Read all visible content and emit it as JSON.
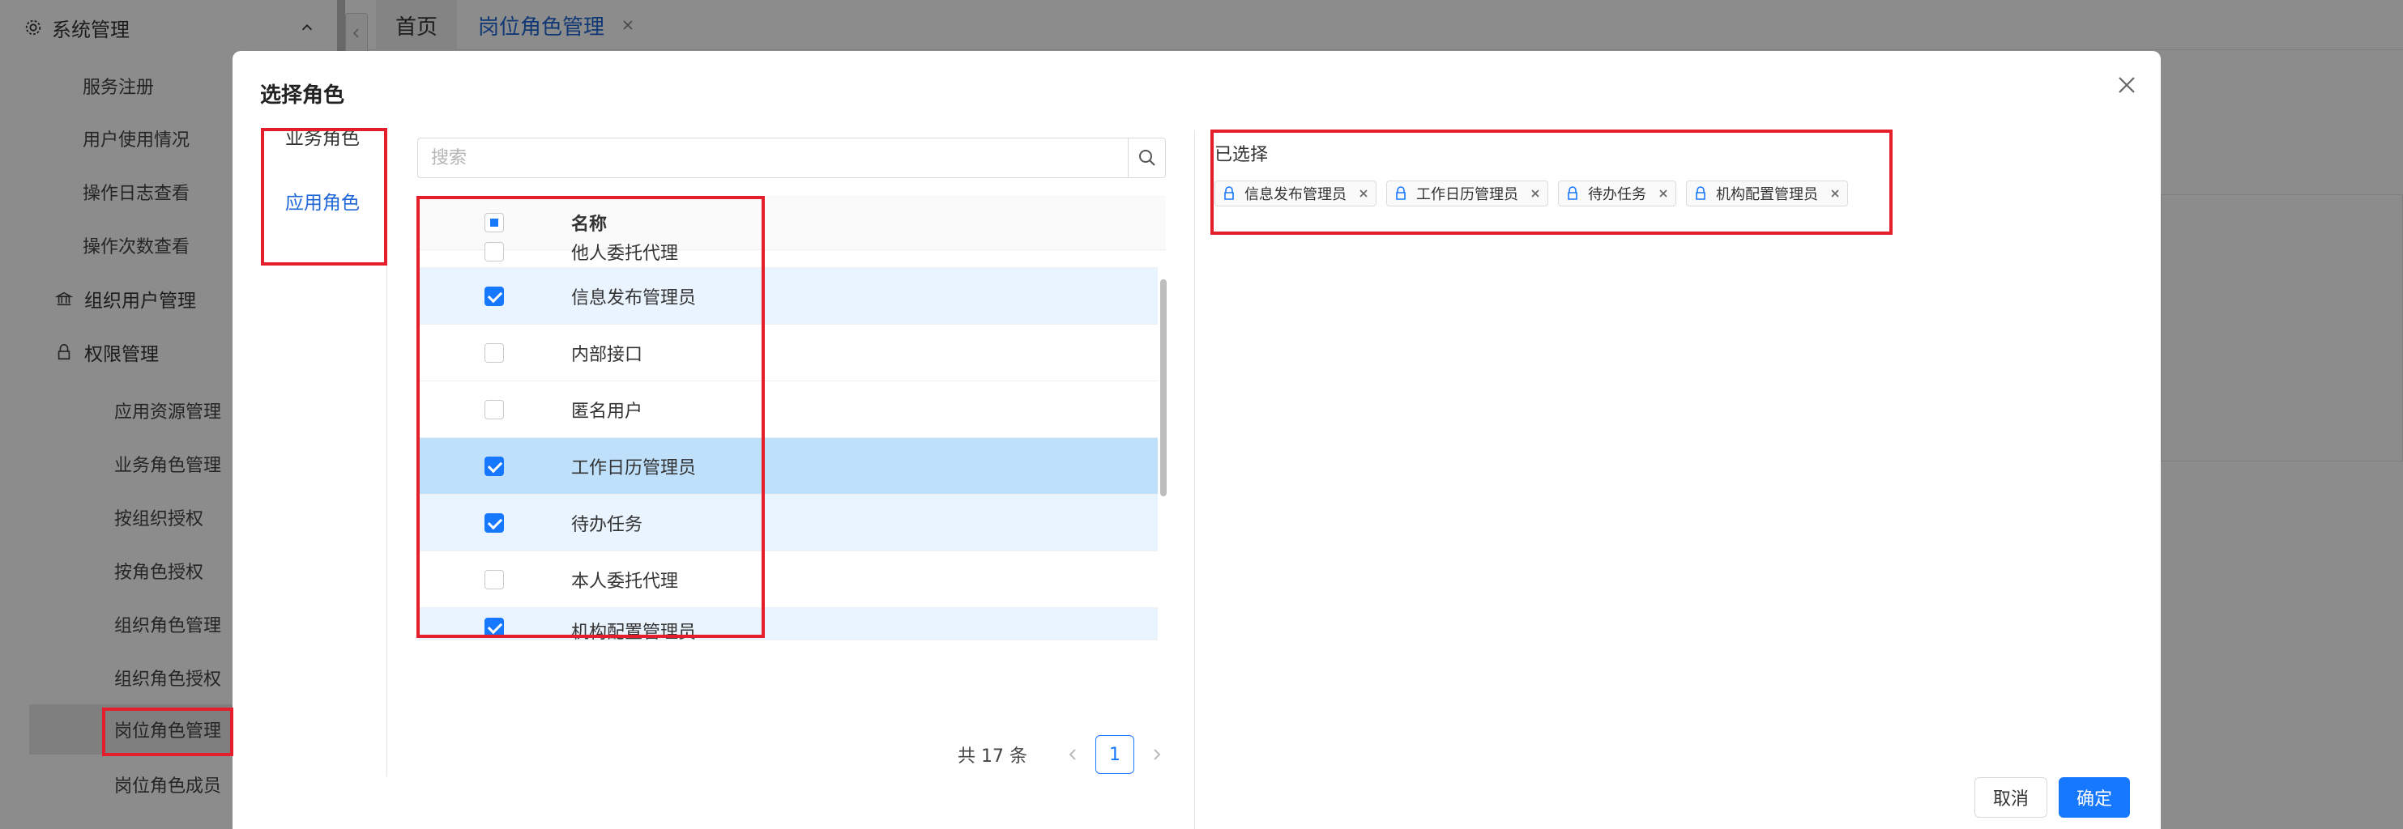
{
  "sidebar": {
    "header": "系统管理",
    "items": [
      {
        "label": "服务注册"
      },
      {
        "label": "用户使用情况"
      },
      {
        "label": "操作日志查看"
      },
      {
        "label": "操作次数查看"
      },
      {
        "label": "组织用户管理"
      },
      {
        "label": "权限管理"
      },
      {
        "label": "应用资源管理"
      },
      {
        "label": "业务角色管理"
      },
      {
        "label": "按组织授权"
      },
      {
        "label": "按角色授权"
      },
      {
        "label": "组织角色管理"
      },
      {
        "label": "组织角色授权"
      },
      {
        "label": "岗位角色管理"
      },
      {
        "label": "岗位角色成员"
      }
    ]
  },
  "tabs": {
    "home": "首页",
    "active": "岗位角色管理"
  },
  "modal": {
    "title": "选择角色",
    "nav": {
      "business": "业务角色",
      "application": "应用角色"
    },
    "search": {
      "placeholder": "搜索",
      "value": ""
    },
    "table": {
      "header_name": "名称",
      "rows": [
        {
          "name": "他人委托代理",
          "checked": false
        },
        {
          "name": "信息发布管理员",
          "checked": true
        },
        {
          "name": "内部接口",
          "checked": false
        },
        {
          "name": "匿名用户",
          "checked": false
        },
        {
          "name": "工作日历管理员",
          "checked": true
        },
        {
          "name": "待办任务",
          "checked": true
        },
        {
          "name": "本人委托代理",
          "checked": false
        },
        {
          "name": "机构配置管理员",
          "checked": true
        }
      ]
    },
    "pagination": {
      "total": "共 17 条",
      "current_page": "1"
    },
    "selected": {
      "title": "已选择",
      "chips": [
        "信息发布管理员",
        "工作日历管理员",
        "待办任务",
        "机构配置管理员"
      ]
    },
    "buttons": {
      "cancel": "取消",
      "ok": "确定"
    }
  },
  "colors": {
    "accent": "#1677ff",
    "highlight": "#e41e2b"
  }
}
